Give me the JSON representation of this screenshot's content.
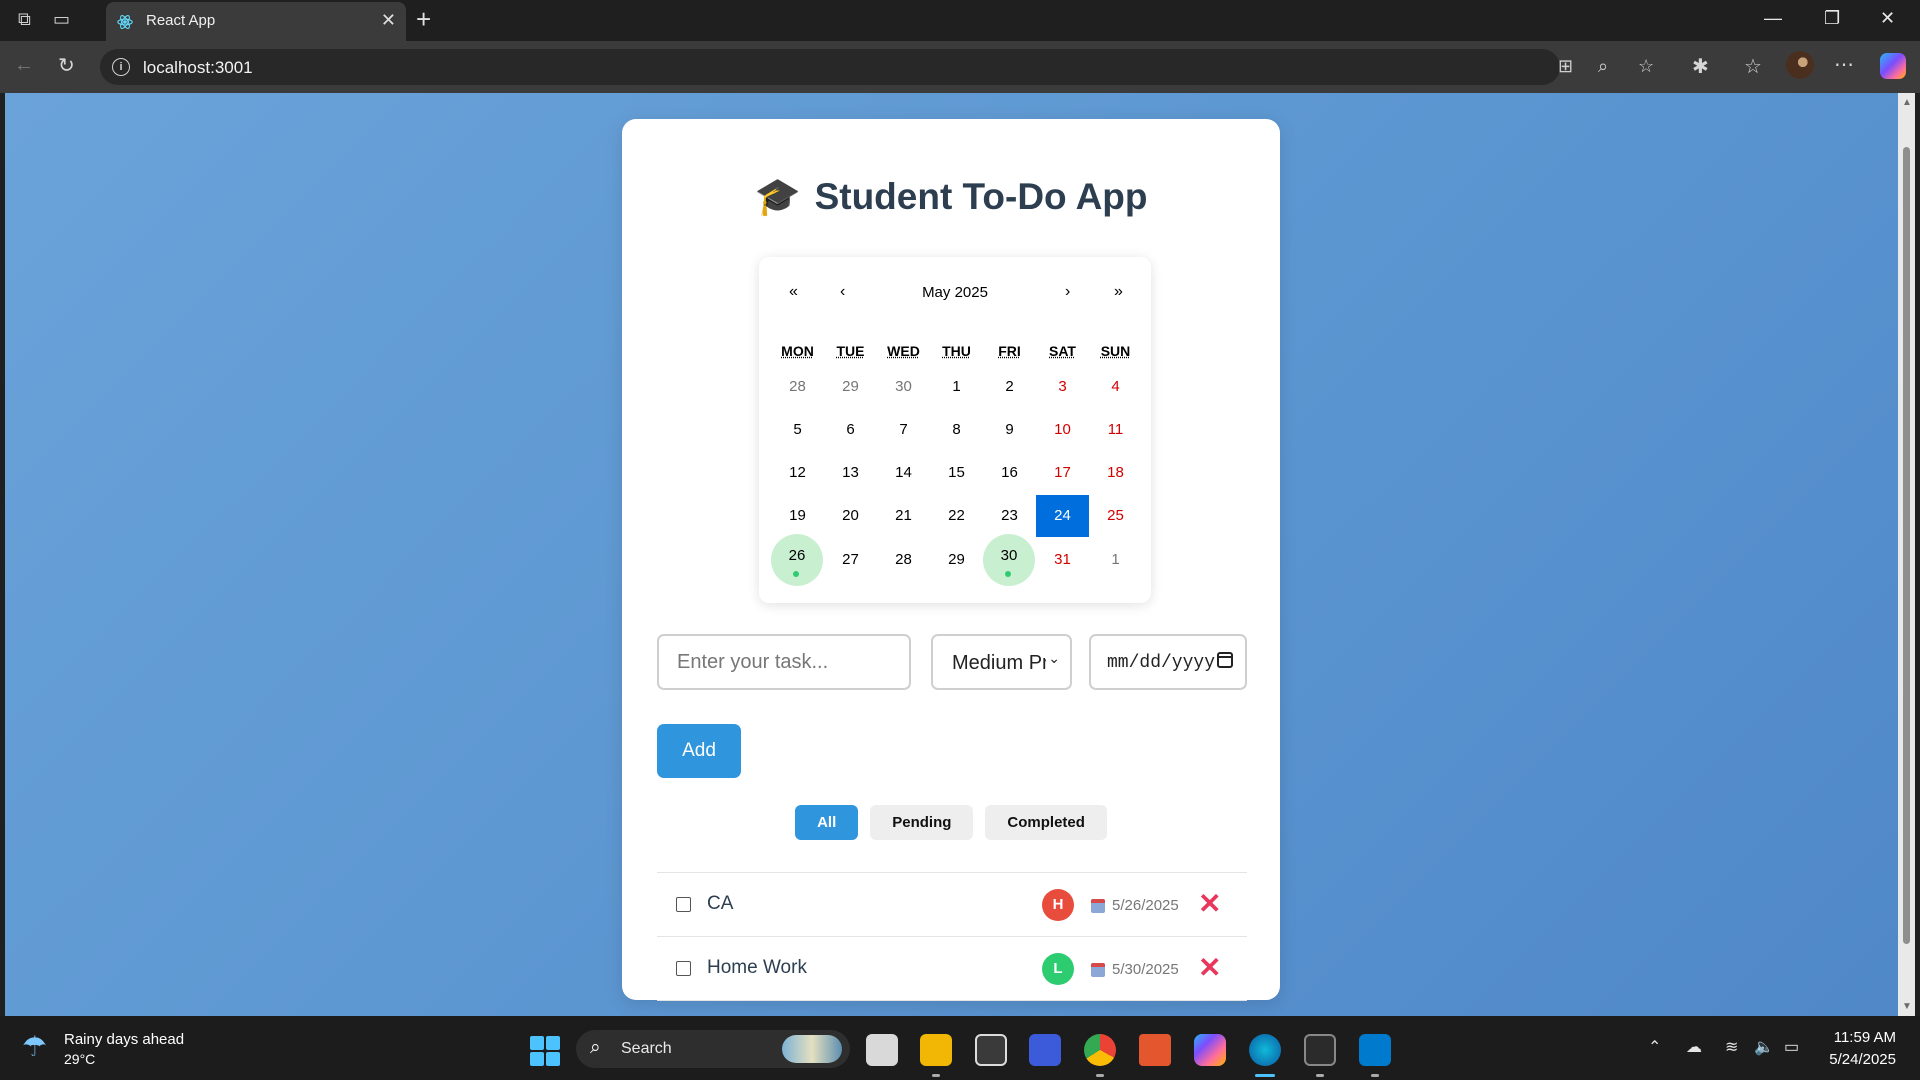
{
  "browser": {
    "tab_title": "React App",
    "url": "localhost:3001"
  },
  "app": {
    "title": "Student To-Do App",
    "title_emoji": "🎓",
    "calendar": {
      "month_label": "May 2025",
      "nav": {
        "prev_year": "«",
        "prev_month": "‹",
        "next_month": "›",
        "next_year": "»"
      },
      "weekdays": [
        "MON",
        "TUE",
        "WED",
        "THU",
        "FRI",
        "SAT",
        "SUN"
      ],
      "weeks": [
        [
          "28",
          "29",
          "30",
          "1",
          "2",
          "3",
          "4"
        ],
        [
          "5",
          "6",
          "7",
          "8",
          "9",
          "10",
          "11"
        ],
        [
          "12",
          "13",
          "14",
          "15",
          "16",
          "17",
          "18"
        ],
        [
          "19",
          "20",
          "21",
          "22",
          "23",
          "24",
          "25"
        ],
        [
          "26",
          "27",
          "28",
          "29",
          "30",
          "31",
          "1"
        ]
      ],
      "today": "24",
      "task_days": [
        "26",
        "30"
      ]
    },
    "form": {
      "task_placeholder": "Enter your task...",
      "priority_value": "Medium Priority",
      "date_placeholder": "mm/dd/yyyy",
      "add_label": "Add"
    },
    "filters": [
      "All",
      "Pending",
      "Completed"
    ],
    "active_filter": "All",
    "tasks": [
      {
        "text": "CA",
        "priority": "H",
        "priority_color": "#e74c3c",
        "date": "5/26/2025",
        "done": false
      },
      {
        "text": "Home Work",
        "priority": "L",
        "priority_color": "#2ecc71",
        "date": "5/30/2025",
        "done": false
      }
    ]
  },
  "taskbar": {
    "weather_title": "Rainy days ahead",
    "weather_temp": "29°C",
    "search_label": "Search",
    "time": "11:59 AM",
    "date": "5/24/2025"
  },
  "colors": {
    "accent": "#2f95dc",
    "today": "#006edc",
    "task_day": "#c8f0d0",
    "delete": "#e8365d"
  }
}
